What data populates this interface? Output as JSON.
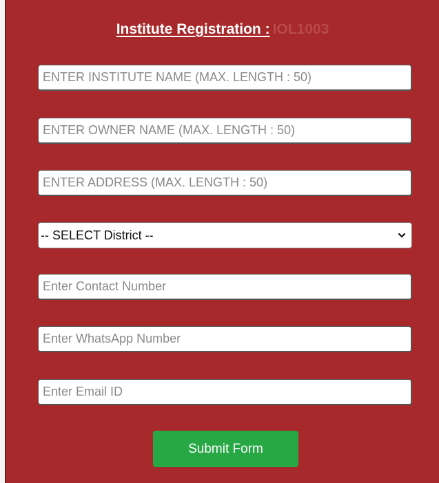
{
  "form": {
    "title": "Institute Registration :",
    "code": "IOL1003",
    "fields": {
      "institute_name": {
        "placeholder": "ENTER INSTITUTE NAME (MAX. LENGTH : 50)",
        "value": ""
      },
      "owner_name": {
        "placeholder": "ENTER OWNER NAME (MAX. LENGTH : 50)",
        "value": ""
      },
      "address": {
        "placeholder": "ENTER ADDRESS (MAX. LENGTH : 50)",
        "value": ""
      },
      "district": {
        "selected": "-- SELECT District --"
      },
      "contact_number": {
        "placeholder": "Enter Contact Number",
        "value": ""
      },
      "whatsapp_number": {
        "placeholder": "Enter WhatsApp Number",
        "value": ""
      },
      "email": {
        "placeholder": "Enter Email ID",
        "value": ""
      }
    },
    "submit_label": "Submit Form"
  },
  "theme": {
    "panel_bg": "#a7292b",
    "button_bg": "#28a745",
    "title_color": "#ffffff"
  },
  "icons": {
    "district_dropdown": "chevron-down-icon"
  }
}
